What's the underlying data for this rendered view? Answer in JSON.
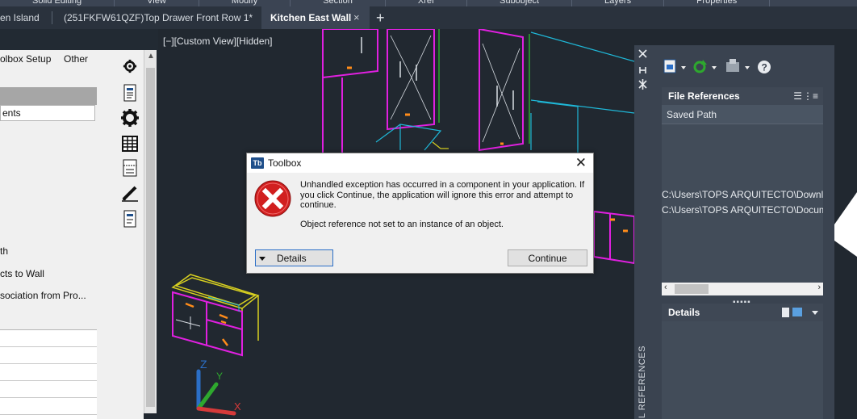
{
  "ribbon": {
    "items": [
      "Solid Editing",
      "View",
      "Modify",
      "Section",
      "Xref",
      "Subobject",
      "Layers",
      "Properties"
    ]
  },
  "tabs": [
    {
      "label": "en Island"
    },
    {
      "label": "(251FKFW61QZF)Top Drawer Front Row 1*"
    },
    {
      "label": "Kitchen East Wall"
    }
  ],
  "tab_close_glyph": "×",
  "tab_add_glyph": "+",
  "left_palette": {
    "tab_setup": "olbox Setup",
    "tab_other": "Other",
    "header_field": "ents",
    "items": [
      "th",
      "cts to Wall",
      "sociation from Pro..."
    ]
  },
  "viewport": {
    "label": "[−][Custom View][Hidden]"
  },
  "right_pane": {
    "file_references_title": "File References",
    "column_saved_path": "Saved Path",
    "paths": [
      "C:\\Users\\TOPS ARQUITECTO\\Downloa",
      "C:\\Users\\TOPS ARQUITECTO\\Docume"
    ],
    "details_title": "Details",
    "vertical_label": "L REFERENCES"
  },
  "dialog": {
    "title": "Toolbox",
    "app_icon_text": "Tb",
    "message": "Unhandled exception has occurred in a component in your application. If you click Continue, the application will ignore this error and attempt to continue.",
    "detail": "Object reference not set to an instance of an object.",
    "details_button": "Details",
    "continue_button": "Continue",
    "close_glyph": "✕"
  },
  "colors": {
    "magenta": "#e020e0",
    "cyan": "#1fb8d8",
    "yellow": "#d8d020",
    "orange": "#ff8c1a",
    "green": "#2ea82e"
  }
}
